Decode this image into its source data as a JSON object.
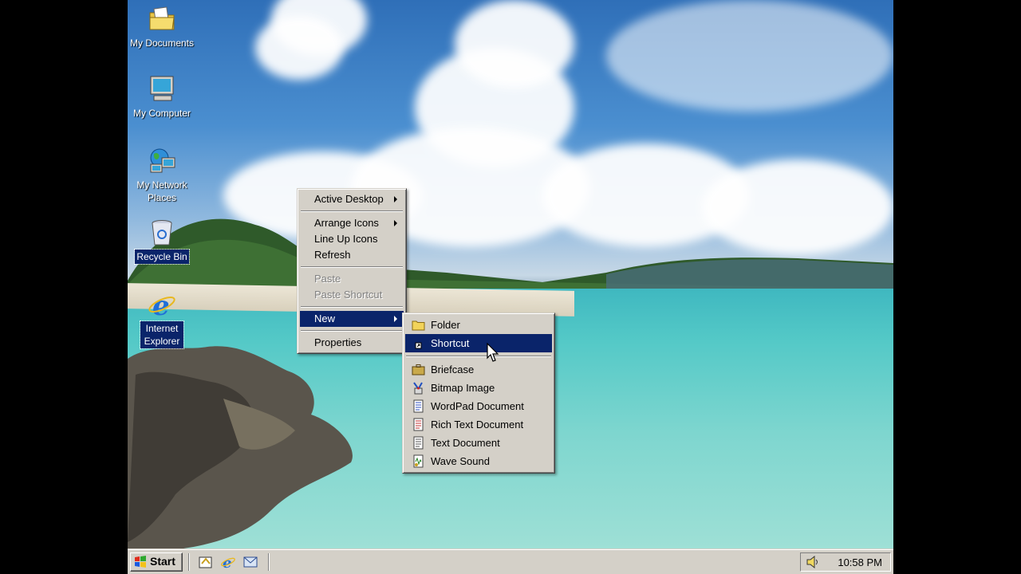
{
  "desktop": {
    "icons": [
      {
        "label": "My Documents"
      },
      {
        "label": "My Computer"
      },
      {
        "label": "My Network Places"
      },
      {
        "label": "Recycle Bin"
      },
      {
        "label": "Internet Explorer"
      }
    ]
  },
  "context_menu": {
    "items": [
      {
        "label": "Active Desktop"
      },
      {
        "label": "Arrange Icons"
      },
      {
        "label": "Line Up Icons"
      },
      {
        "label": "Refresh"
      },
      {
        "label": "Paste"
      },
      {
        "label": "Paste Shortcut"
      },
      {
        "label": "New"
      },
      {
        "label": "Properties"
      }
    ]
  },
  "new_submenu": {
    "items": [
      {
        "label": "Folder"
      },
      {
        "label": "Shortcut"
      },
      {
        "label": "Briefcase"
      },
      {
        "label": "Bitmap Image"
      },
      {
        "label": "WordPad Document"
      },
      {
        "label": "Rich Text Document"
      },
      {
        "label": "Text Document"
      },
      {
        "label": "Wave Sound"
      }
    ]
  },
  "taskbar": {
    "start_label": "Start",
    "clock": "10:58 PM"
  },
  "colors": {
    "highlight": "#0a246a",
    "face": "#d4d0c8"
  }
}
